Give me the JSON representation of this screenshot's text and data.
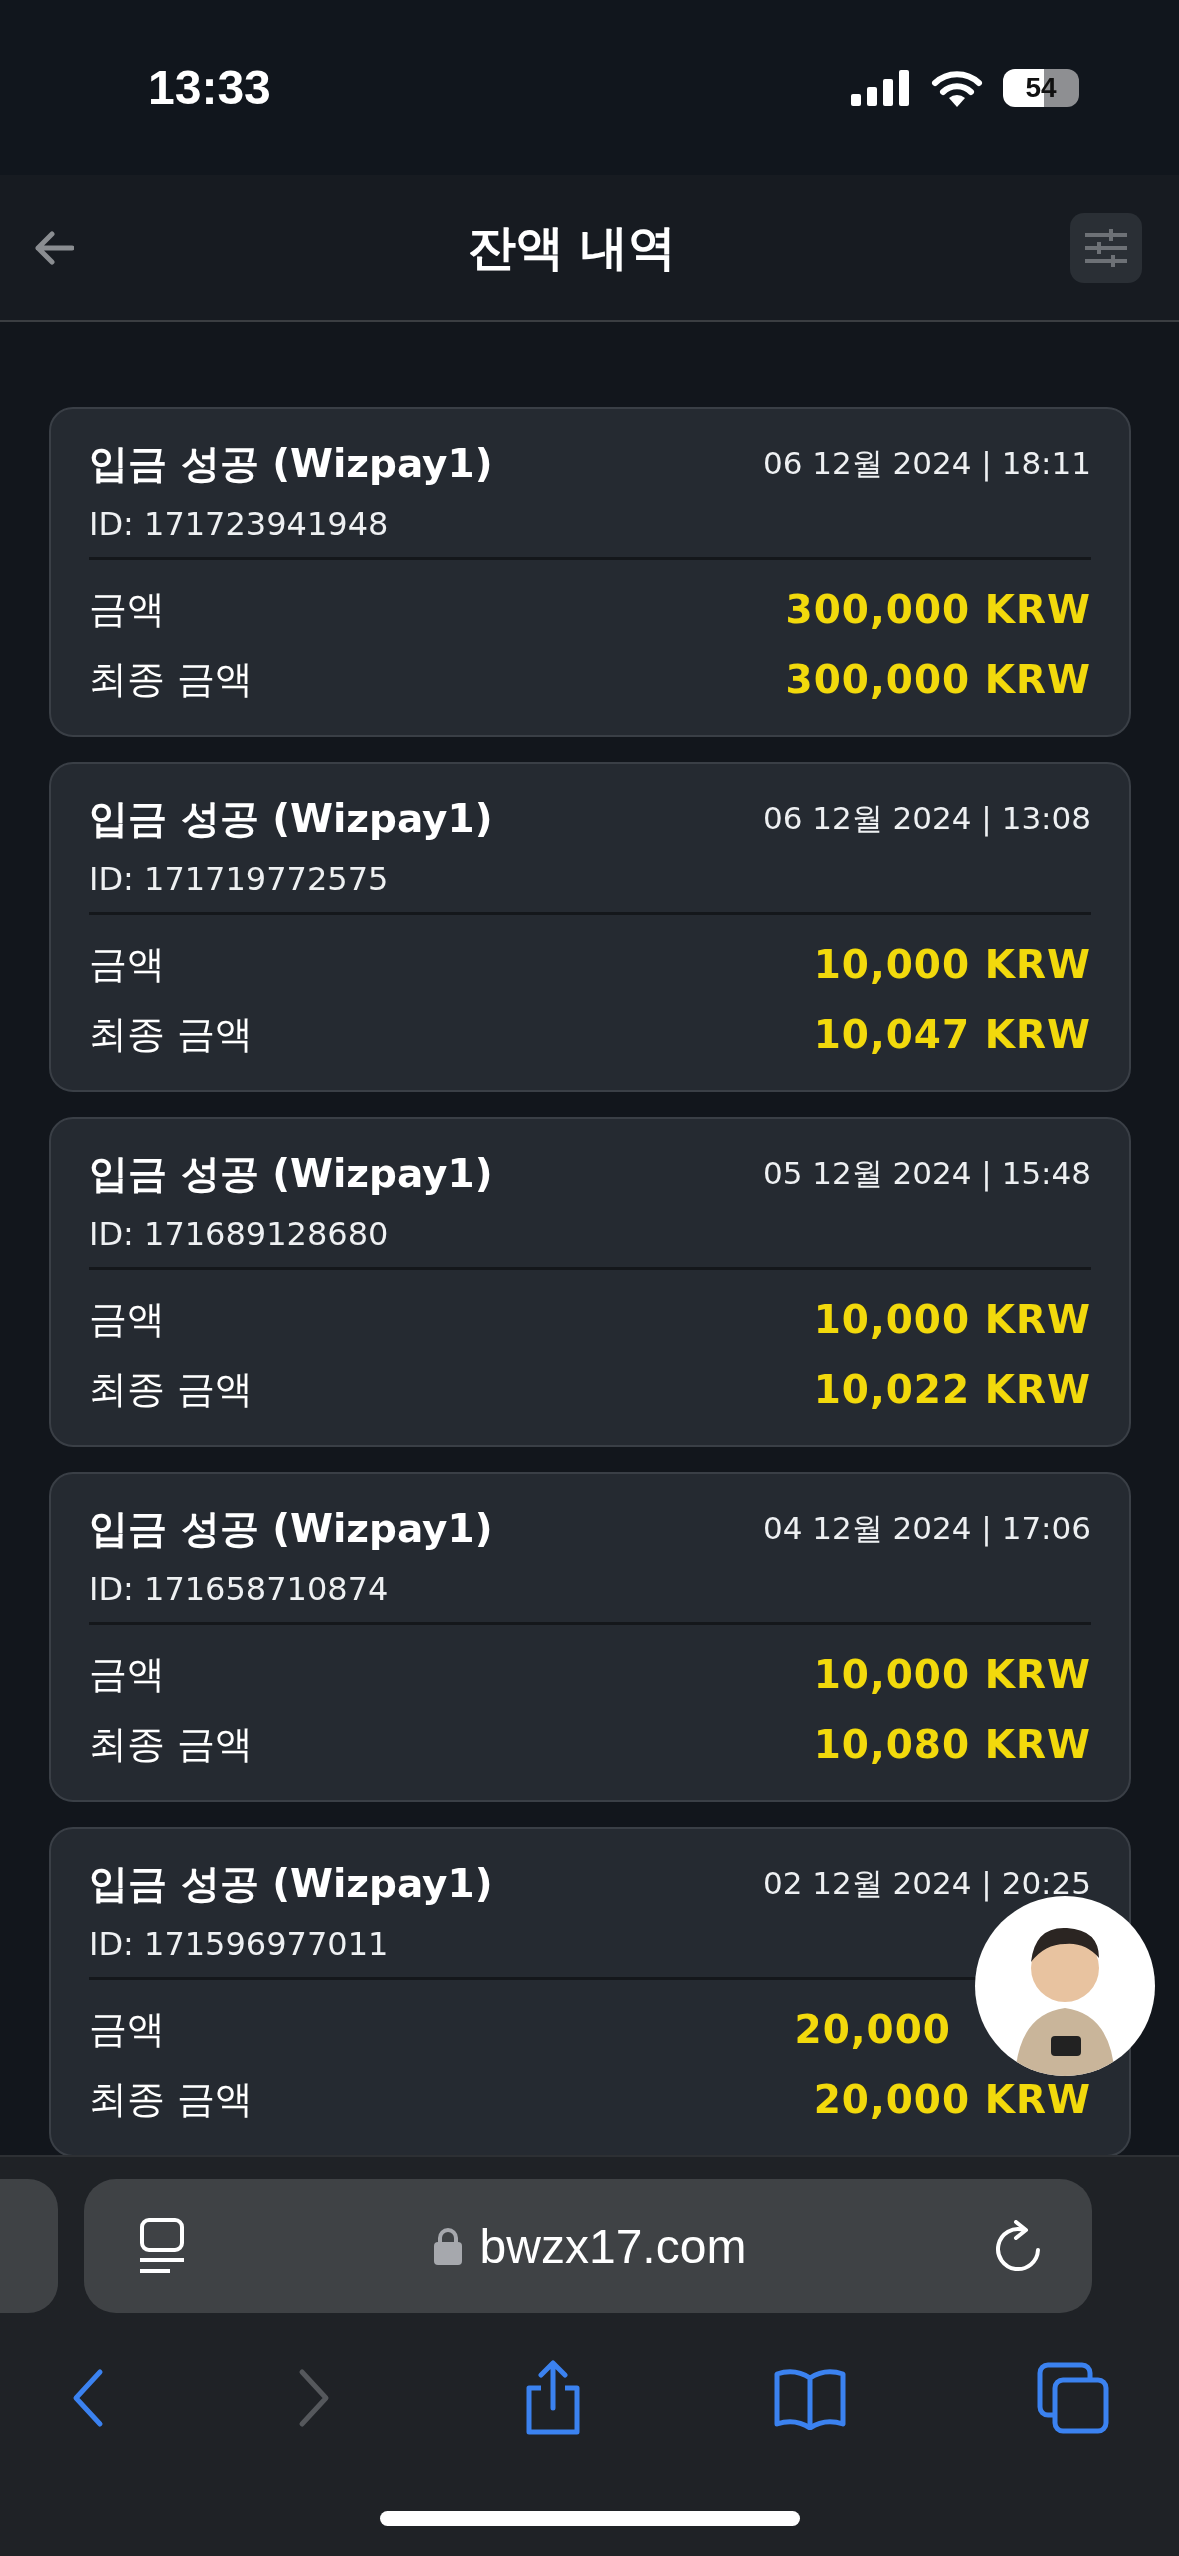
{
  "status_bar": {
    "time": "13:33",
    "battery": "54"
  },
  "header": {
    "title": "잔액 내역"
  },
  "transactions": [
    {
      "title": "입금 성공 (Wizpay1)",
      "date": "06 12월 2024 | 18:11",
      "id": "ID: 171723941948",
      "rows": [
        {
          "label": "금액",
          "value": "300,000 KRW",
          "clipped": false
        },
        {
          "label": "최종 금액",
          "value": "300,000 KRW",
          "clipped": false
        }
      ]
    },
    {
      "title": "입금 성공 (Wizpay1)",
      "date": "06 12월 2024 | 13:08",
      "id": "ID: 171719772575",
      "rows": [
        {
          "label": "금액",
          "value": "10,000 KRW",
          "clipped": false
        },
        {
          "label": "최종 금액",
          "value": "10,047 KRW",
          "clipped": false
        }
      ]
    },
    {
      "title": "입금 성공 (Wizpay1)",
      "date": "05 12월 2024 | 15:48",
      "id": "ID: 171689128680",
      "rows": [
        {
          "label": "금액",
          "value": "10,000 KRW",
          "clipped": false
        },
        {
          "label": "최종 금액",
          "value": "10,022 KRW",
          "clipped": false
        }
      ]
    },
    {
      "title": "입금 성공 (Wizpay1)",
      "date": "04 12월 2024 | 17:06",
      "id": "ID: 171658710874",
      "rows": [
        {
          "label": "금액",
          "value": "10,000 KRW",
          "clipped": false
        },
        {
          "label": "최종 금액",
          "value": "10,080 KRW",
          "clipped": false
        }
      ]
    },
    {
      "title": "입금 성공 (Wizpay1)",
      "date": "02 12월 2024 | 20:25",
      "id": "ID: 171596977011",
      "rows": [
        {
          "label": "금액",
          "value": "20,000",
          "clipped": true
        },
        {
          "label": "최종 금액",
          "value": "20,000 KRW",
          "clipped": false
        }
      ]
    }
  ],
  "browser": {
    "url": "bwzx17.com"
  }
}
